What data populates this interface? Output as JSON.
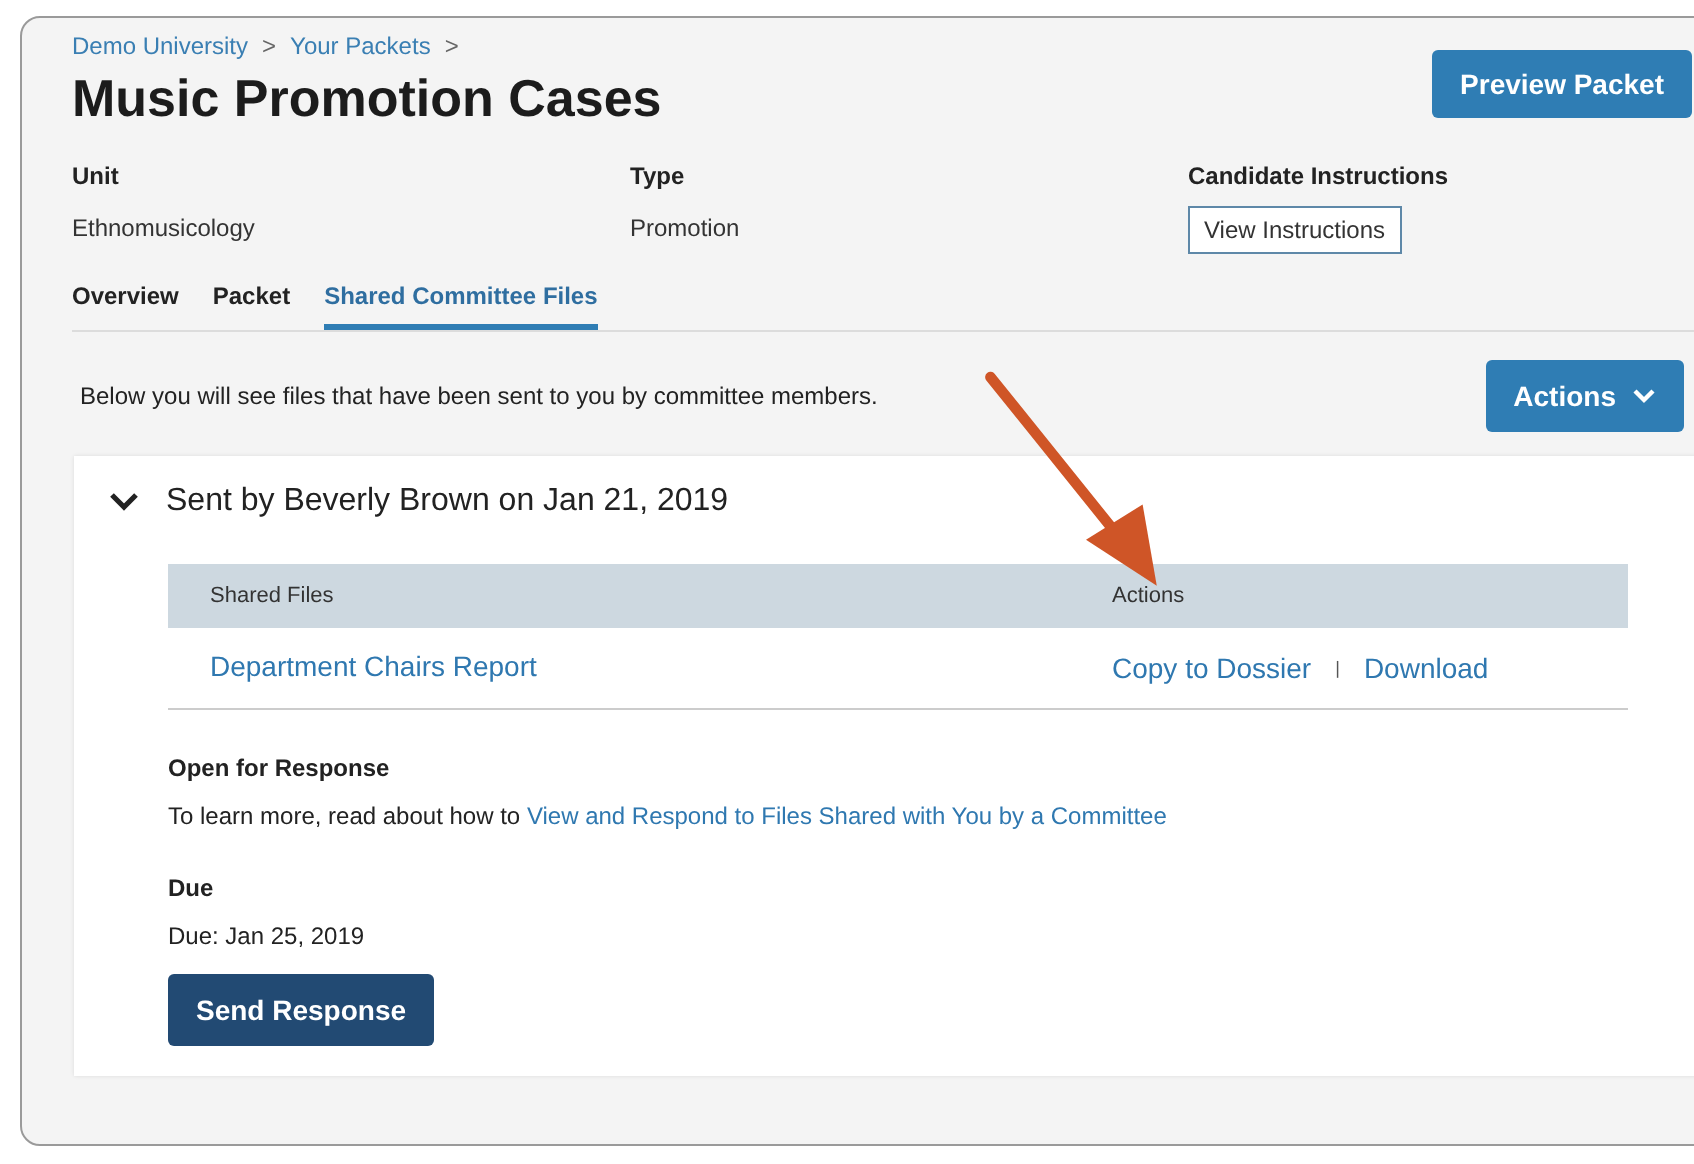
{
  "breadcrumbs": [
    "Demo University",
    "Your Packets"
  ],
  "breadcrumb_separator": ">",
  "title": "Music Promotion Cases",
  "preview_button": "Preview Packet",
  "fields": [
    {
      "label": "Unit",
      "value": "Ethnomusicology",
      "kind": "text"
    },
    {
      "label": "Type",
      "value": "Promotion",
      "kind": "text"
    },
    {
      "label": "Candidate Instructions",
      "value": "View Instructions",
      "kind": "button"
    }
  ],
  "tabs": [
    {
      "label": "Overview",
      "selected": false
    },
    {
      "label": "Packet",
      "selected": false
    },
    {
      "label": "Shared Committee Files",
      "selected": true
    }
  ],
  "intro": "Below you will see files that have been sent to you by committee members.",
  "actions_button": "Actions",
  "section": {
    "title": "Sent by Beverly Brown on Jan 21, 2019",
    "expanded": true,
    "table": {
      "columns": [
        "Shared Files",
        "Actions"
      ],
      "rows": [
        {
          "file": "Department Chairs Report",
          "actions": [
            "Copy to Dossier",
            "Download"
          ],
          "separator": "|"
        }
      ]
    },
    "open_heading": "Open for Response",
    "learn_text": "To learn more, read about how to",
    "learn_link": "View and Respond to Files Shared with You by a Committee",
    "due_heading": "Due",
    "due_text": "Due: Jan 25, 2019",
    "send_button": "Send Response"
  }
}
